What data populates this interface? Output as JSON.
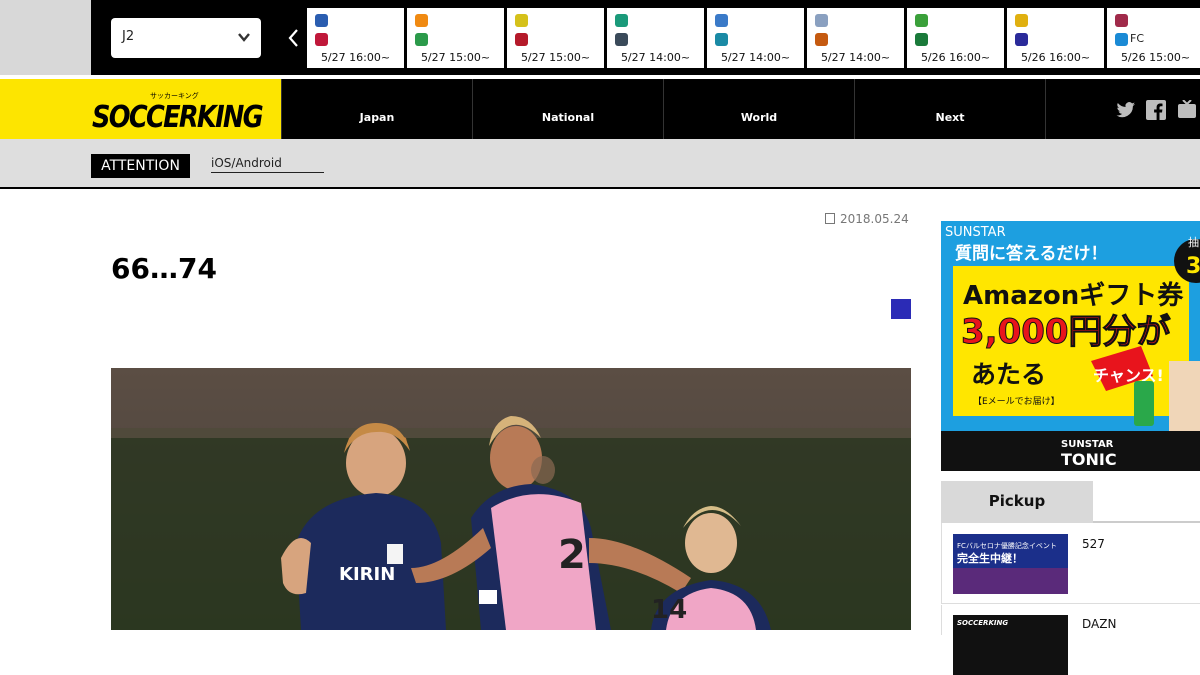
{
  "top": {
    "league_value": "J2",
    "matches": [
      {
        "time": "5/27 16:00~",
        "team_b": "",
        "c1": "#2a5db0",
        "c2": "#c0183a"
      },
      {
        "time": "5/27 15:00~",
        "team_b": "",
        "c1": "#f08a12",
        "c2": "#2b9a4a"
      },
      {
        "time": "5/27 15:00~",
        "team_b": "",
        "c1": "#d5c11a",
        "c2": "#b51a2a"
      },
      {
        "time": "5/27 14:00~",
        "team_b": "",
        "c1": "#1a9a7a",
        "c2": "#3a4a5a"
      },
      {
        "time": "5/27 14:00~",
        "team_b": "",
        "c1": "#3a7ac8",
        "c2": "#1a8aa5"
      },
      {
        "time": "5/27 14:00~",
        "team_b": "",
        "c1": "#8aa0c0",
        "c2": "#c55a10"
      },
      {
        "time": "5/26 16:00~",
        "team_b": "",
        "c1": "#3aa03a",
        "c2": "#1a7a3a"
      },
      {
        "time": "5/26 16:00~",
        "team_b": "",
        "c1": "#e0b010",
        "c2": "#2a2a9a"
      },
      {
        "time": "5/26 15:00~",
        "team_b": "FC",
        "c1": "#a02a4a",
        "c2": "#1a8ad5"
      }
    ]
  },
  "header": {
    "logo_text": "SOCCERKING",
    "logo_kana": "サッカーキング",
    "nav": [
      "Japan",
      "National",
      "World",
      "Next"
    ]
  },
  "attention": {
    "label": "ATTENTION",
    "link": "iOS/Android"
  },
  "article": {
    "date": "2018.05.24",
    "title": "66…74",
    "category_color": "#2b2bb6"
  },
  "ad": {
    "brand": "SUNSTAR",
    "line1": "質問に答えるだけ！",
    "line2": "Amazonギフト券",
    "line3": "3,000円分が",
    "line4": "あたる",
    "line4b": "チャンス!",
    "line5": "【Eメールでお届け】",
    "badge_top": "抽",
    "badge_mid": "3",
    "footer_brand": "SUNSTAR",
    "footer_product": "TONIC"
  },
  "sidebar": {
    "pickup_label": "Pickup",
    "items": [
      {
        "text": "527",
        "thumb_line1": "FCバルセロナ優勝記念イベント",
        "thumb_line2": "完全生中継！"
      },
      {
        "text": "DAZN",
        "thumb_line1": "SOCCERKING",
        "thumb_line2": ""
      }
    ]
  }
}
